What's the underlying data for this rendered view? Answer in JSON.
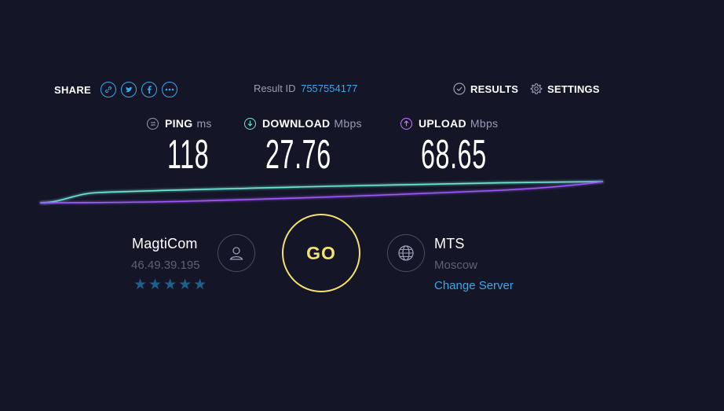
{
  "share": {
    "label": "SHARE",
    "icons": [
      "link-icon",
      "twitter-icon",
      "facebook-icon",
      "more-icon"
    ]
  },
  "result": {
    "label": "Result ID",
    "id": "7557554177"
  },
  "nav": {
    "results": "RESULTS",
    "settings": "SETTINGS"
  },
  "metrics": {
    "ping": {
      "label": "PING",
      "unit": "ms",
      "value": "118"
    },
    "download": {
      "label": "DOWNLOAD",
      "unit": "Mbps",
      "value": "27.76"
    },
    "upload": {
      "label": "UPLOAD",
      "unit": "Mbps",
      "value": "68.65"
    }
  },
  "isp": {
    "name": "MagtiCom",
    "ip": "46.49.39.195",
    "stars": "★★★★★",
    "rating": 5
  },
  "go": {
    "label": "GO"
  },
  "server": {
    "name": "MTS",
    "city": "Moscow",
    "change": "Change Server"
  },
  "colors": {
    "background": "#141526",
    "accent": "#3aa9ea",
    "download_line": "#6ee7d6",
    "upload_line": "#a259ff",
    "go": "#f5e170"
  }
}
